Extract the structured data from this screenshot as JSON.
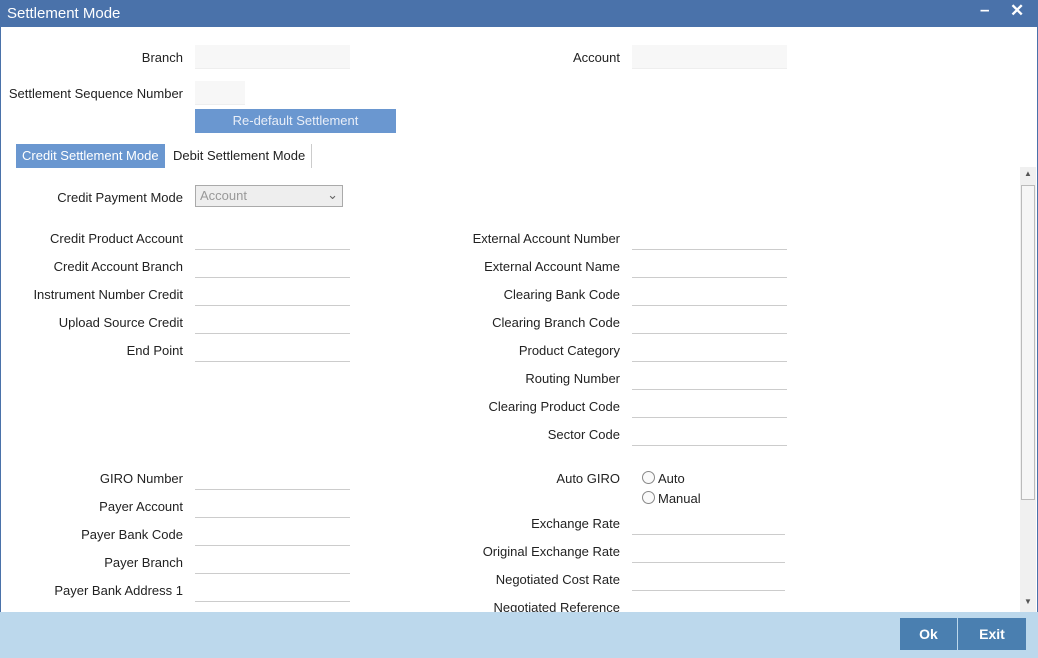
{
  "window": {
    "title": "Settlement Mode",
    "minimize_icon": "minimize-icon",
    "close_icon": "close-icon"
  },
  "header": {
    "branch_label": "Branch",
    "account_label": "Account",
    "sequence_label": "Settlement Sequence Number",
    "redefault_label": "Re-default Settlement"
  },
  "tabs": [
    {
      "label": "Credit Settlement Mode",
      "active": true
    },
    {
      "label": "Debit Settlement Mode",
      "active": false
    }
  ],
  "payment_mode": {
    "label": "Credit Payment Mode",
    "value": "Account"
  },
  "left_fields": [
    "Credit Product Account",
    "Credit Account Branch",
    "Instrument Number Credit",
    "Upload Source Credit",
    "End Point"
  ],
  "right_fields": [
    "External Account Number",
    "External Account Name",
    "Clearing Bank Code",
    "Clearing Branch Code",
    "Product Category",
    "Routing Number",
    "Clearing Product Code",
    "Sector Code"
  ],
  "left_fields2": [
    "GIRO Number",
    "Payer Account",
    "Payer Bank Code",
    "Payer Branch",
    "Payer Bank Address 1"
  ],
  "auto_giro": {
    "label": "Auto GIRO",
    "options": [
      "Auto",
      "Manual"
    ]
  },
  "right_fields2": [
    "Exchange Rate",
    "Original Exchange Rate",
    "Negotiated Cost Rate",
    "Negotiated Reference"
  ],
  "footer": {
    "ok_label": "Ok",
    "exit_label": "Exit"
  }
}
